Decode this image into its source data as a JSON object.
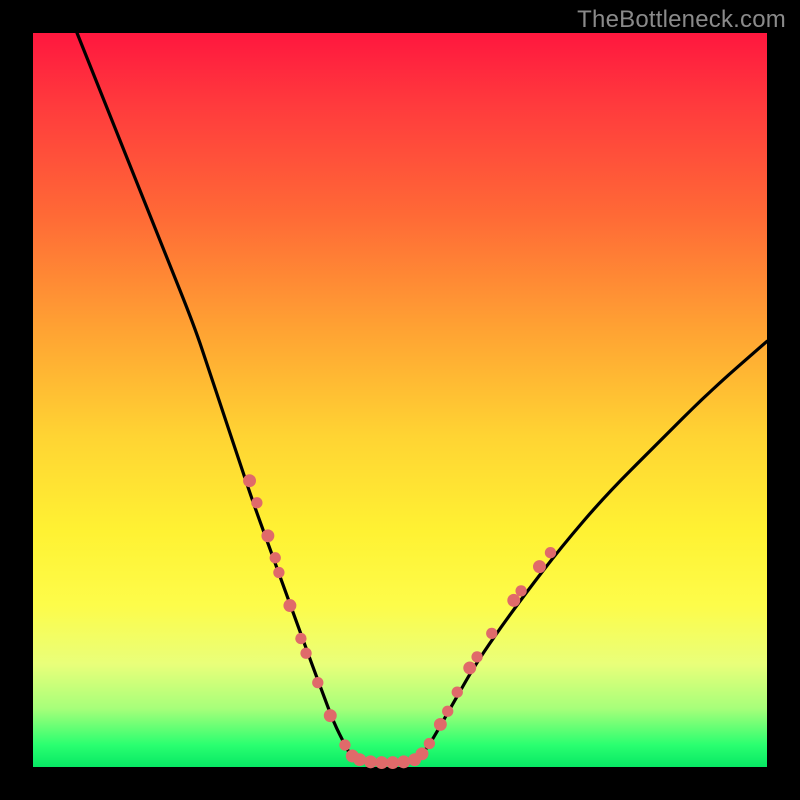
{
  "watermark": "TheBottleneck.com",
  "colors": {
    "frame": "#000000",
    "gradient_top": "#ff173e",
    "gradient_mid": "#fff233",
    "gradient_bottom": "#07e864",
    "curve": "#000000",
    "dots": "#e06a6a"
  },
  "chart_data": {
    "type": "line",
    "title": "",
    "xlabel": "",
    "ylabel": "",
    "xlim": [
      0,
      100
    ],
    "ylim": [
      0,
      100
    ],
    "grid": false,
    "series": [
      {
        "name": "left-branch",
        "x": [
          6,
          10,
          14,
          18,
          22,
          24,
          26,
          28,
          30,
          32,
          34,
          36,
          38,
          39.5,
          41,
          42.5,
          43.5
        ],
        "y": [
          100,
          90,
          80,
          70,
          60,
          54,
          48,
          42,
          36,
          30.5,
          25,
          19.5,
          14,
          10,
          6,
          3,
          1.2
        ]
      },
      {
        "name": "trough",
        "x": [
          43.5,
          45,
          47,
          49,
          51,
          52.5
        ],
        "y": [
          1.2,
          0.6,
          0.5,
          0.5,
          0.6,
          1.2
        ]
      },
      {
        "name": "right-branch",
        "x": [
          52.5,
          54,
          56,
          58,
          60,
          63,
          67,
          72,
          78,
          85,
          92,
          100
        ],
        "y": [
          1.2,
          3,
          6.5,
          10,
          13.5,
          18,
          23.5,
          30,
          37,
          44,
          51,
          58
        ]
      }
    ],
    "markers": [
      {
        "x": 29.5,
        "y": 39.0,
        "r": 1.6
      },
      {
        "x": 30.5,
        "y": 36.0,
        "r": 1.4
      },
      {
        "x": 32.0,
        "y": 31.5,
        "r": 1.6
      },
      {
        "x": 33.0,
        "y": 28.5,
        "r": 1.4
      },
      {
        "x": 33.5,
        "y": 26.5,
        "r": 1.4
      },
      {
        "x": 35.0,
        "y": 22.0,
        "r": 1.6
      },
      {
        "x": 36.5,
        "y": 17.5,
        "r": 1.4
      },
      {
        "x": 37.2,
        "y": 15.5,
        "r": 1.4
      },
      {
        "x": 38.8,
        "y": 11.5,
        "r": 1.4
      },
      {
        "x": 40.5,
        "y": 7.0,
        "r": 1.6
      },
      {
        "x": 42.5,
        "y": 3.0,
        "r": 1.4
      },
      {
        "x": 43.5,
        "y": 1.5,
        "r": 1.6
      },
      {
        "x": 44.5,
        "y": 1.0,
        "r": 1.6
      },
      {
        "x": 46.0,
        "y": 0.7,
        "r": 1.6
      },
      {
        "x": 47.5,
        "y": 0.6,
        "r": 1.6
      },
      {
        "x": 49.0,
        "y": 0.6,
        "r": 1.6
      },
      {
        "x": 50.5,
        "y": 0.7,
        "r": 1.6
      },
      {
        "x": 52.0,
        "y": 1.0,
        "r": 1.6
      },
      {
        "x": 53.0,
        "y": 1.8,
        "r": 1.6
      },
      {
        "x": 54.0,
        "y": 3.2,
        "r": 1.4
      },
      {
        "x": 55.5,
        "y": 5.8,
        "r": 1.6
      },
      {
        "x": 56.5,
        "y": 7.6,
        "r": 1.4
      },
      {
        "x": 57.8,
        "y": 10.2,
        "r": 1.4
      },
      {
        "x": 59.5,
        "y": 13.5,
        "r": 1.6
      },
      {
        "x": 60.5,
        "y": 15.0,
        "r": 1.4
      },
      {
        "x": 62.5,
        "y": 18.2,
        "r": 1.4
      },
      {
        "x": 65.5,
        "y": 22.7,
        "r": 1.6
      },
      {
        "x": 66.5,
        "y": 24.0,
        "r": 1.4
      },
      {
        "x": 69.0,
        "y": 27.3,
        "r": 1.6
      },
      {
        "x": 70.5,
        "y": 29.2,
        "r": 1.4
      }
    ]
  }
}
